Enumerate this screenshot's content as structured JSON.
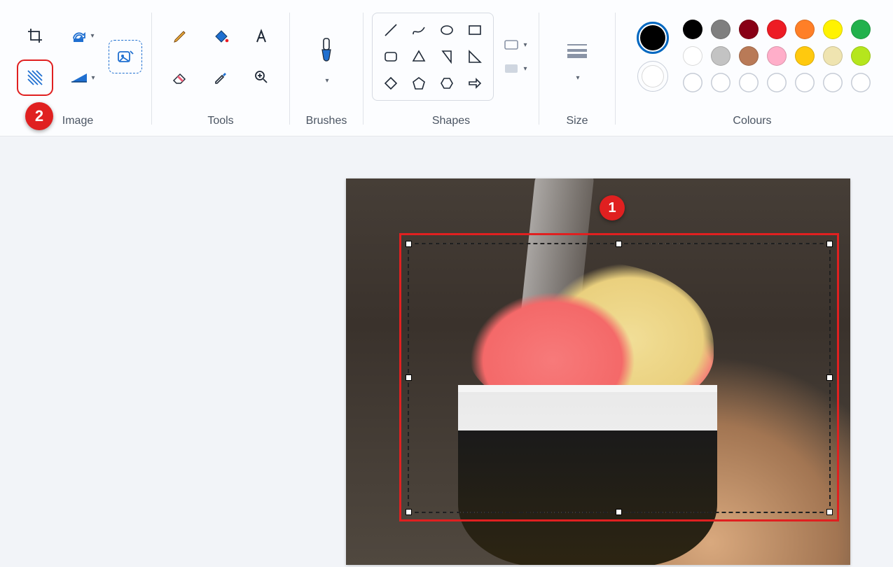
{
  "ribbon": {
    "image": {
      "label": "Image",
      "crop": "Crop",
      "rotate": "Rotate",
      "flip": "Flip",
      "resize": "Resize",
      "selection": "Selection"
    },
    "tools": {
      "label": "Tools",
      "pencil": "Pencil",
      "fill": "Fill",
      "text": "Text",
      "eraser": "Eraser",
      "picker": "Colour picker",
      "magnifier": "Magnifier"
    },
    "brushes": {
      "label": "Brushes"
    },
    "shapes": {
      "label": "Shapes",
      "outline": "Outline",
      "fill": "Fill"
    },
    "size": {
      "label": "Size"
    },
    "colours": {
      "label": "Colours",
      "current1": "#000000",
      "current2": "#ffffff",
      "palette_row1": [
        "#000000",
        "#7f7f7f",
        "#880015",
        "#ed1c24",
        "#ff7f27",
        "#fff200",
        "#22b14c"
      ],
      "palette_row2": [
        "#ffffff",
        "#c3c3c3",
        "#b97a57",
        "#ffaec9",
        "#ffc90e",
        "#efe4b0",
        "#b5e61d"
      ]
    }
  },
  "callouts": {
    "one": "1",
    "two": "2"
  }
}
